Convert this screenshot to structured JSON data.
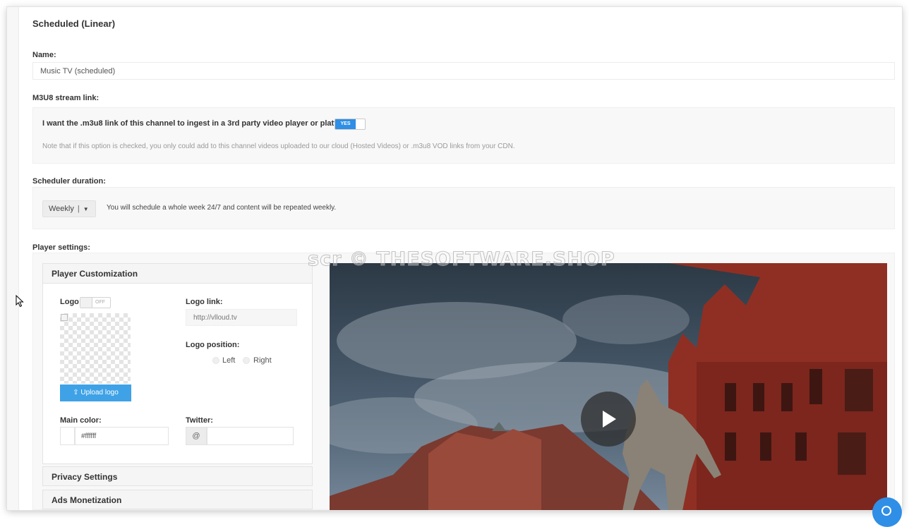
{
  "page": {
    "title": "Scheduled (Linear)"
  },
  "name_field": {
    "label": "Name:",
    "value": "Music TV (scheduled)"
  },
  "m3u8": {
    "label": "M3U8 stream link:",
    "question": "I want the .m3u8 link of this channel to ingest in a 3rd party video player or platform:",
    "toggle_label": "YES",
    "toggle_state": "on",
    "note": "Note that if this option is checked, you only could add to this channel videos uploaded to our cloud (Hosted Videos) or .m3u8 VOD links from your CDN."
  },
  "scheduler": {
    "label": "Scheduler duration:",
    "selected": "Weekly",
    "description": "You will schedule a whole week 24/7 and content will be repeated weekly."
  },
  "player_settings": {
    "label": "Player settings:",
    "customization": {
      "title": "Player Customization",
      "logo_label": "Logo:",
      "logo_toggle_label": "OFF",
      "upload_label": "Upload logo",
      "logo_link_label": "Logo link:",
      "logo_link_placeholder": "http://vlloud.tv",
      "logo_position_label": "Logo position:",
      "position_left": "Left",
      "position_right": "Right",
      "main_color_label": "Main color:",
      "main_color_value": "#ffffff",
      "twitter_label": "Twitter:",
      "twitter_prefix": "@"
    },
    "privacy_title": "Privacy Settings",
    "ads_title": "Ads Monetization"
  },
  "watermark": "scr © THESOFTWARE.SHOP",
  "colors": {
    "accent": "#2f8ee5",
    "upload_button": "#3fa2e6",
    "well_background": "#f8f8f8"
  },
  "icons": {
    "play": "play-icon",
    "upload": "upload-icon",
    "caret": "caret-down-icon",
    "chat": "chat-icon"
  }
}
